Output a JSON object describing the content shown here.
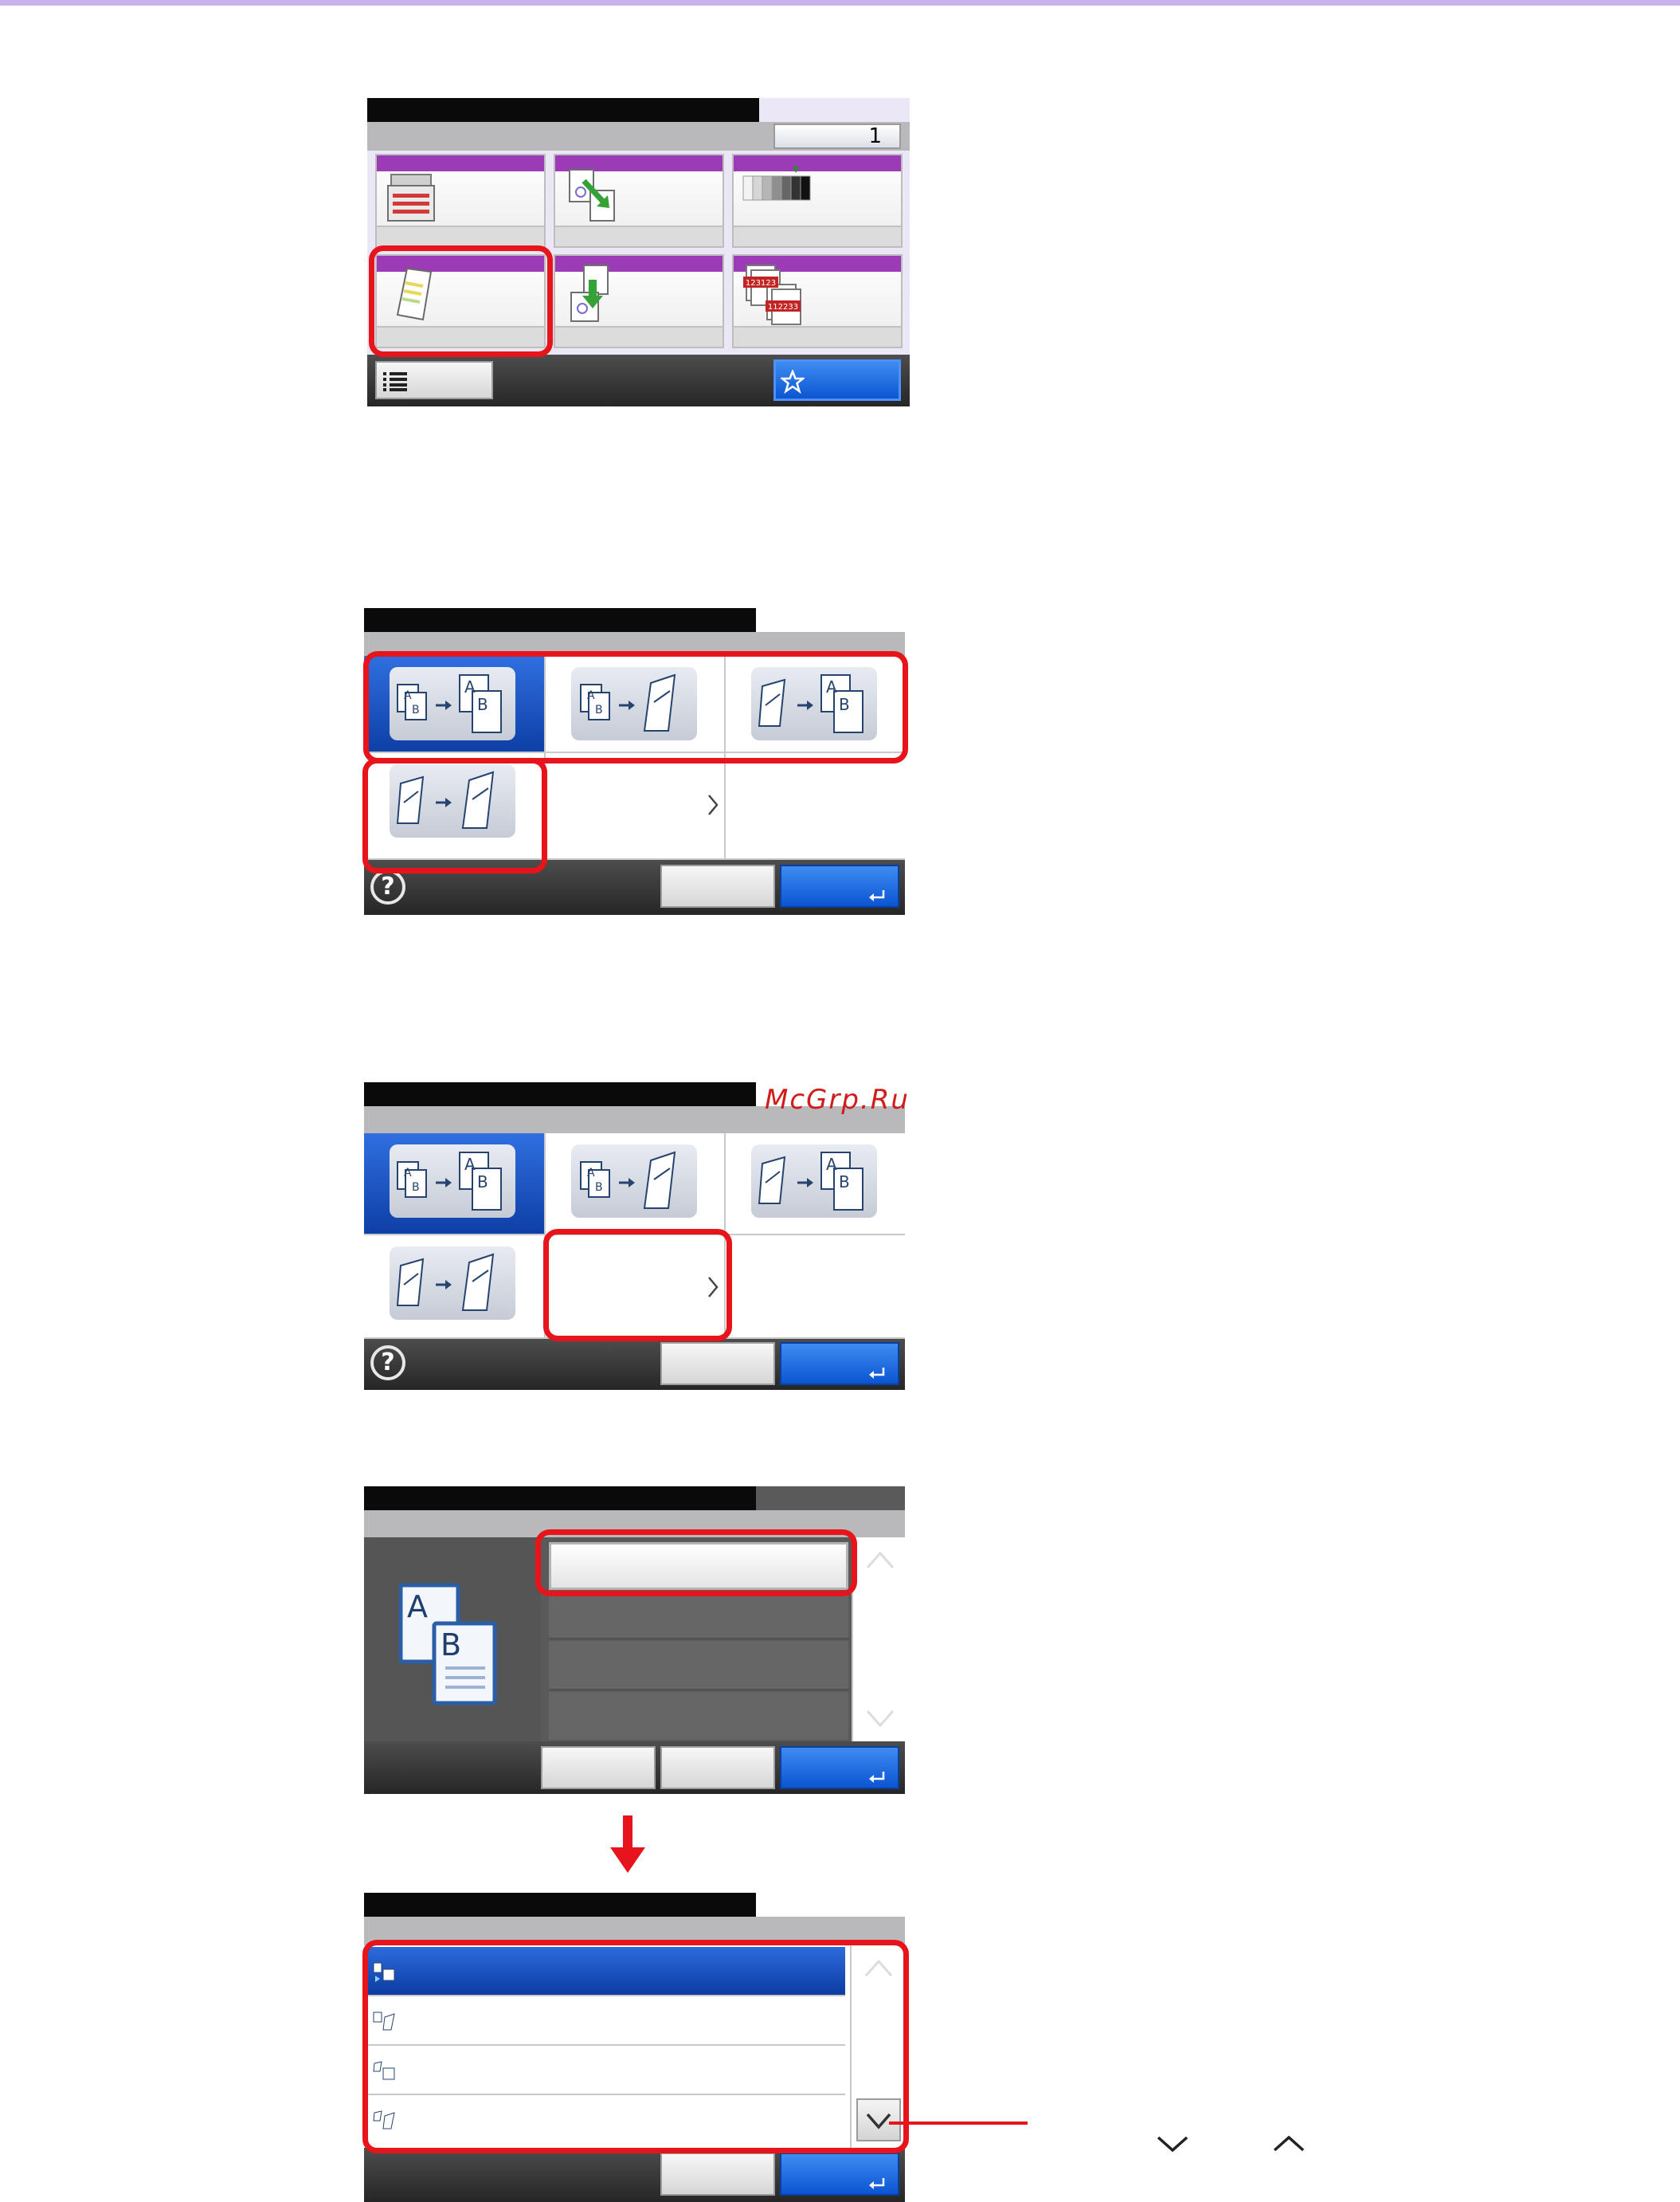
{
  "screen1": {
    "counter_value": "1",
    "tiles": [
      {
        "name": "copier-icon"
      },
      {
        "name": "sheet-swap-icon"
      },
      {
        "name": "density-icon"
      },
      {
        "name": "duplex-icon"
      },
      {
        "name": "originals-icon"
      },
      {
        "name": "collate-icon"
      }
    ],
    "collate_numbers": [
      "123123",
      "112233"
    ]
  },
  "duplex_icon_letters": {
    "a": "A",
    "b": "B"
  },
  "watermark": "McGrp.Ru",
  "colors": {
    "highlight": "#e8141b",
    "accent_blue": "#0e3fa6",
    "tile_header": "#9b3bb6"
  }
}
